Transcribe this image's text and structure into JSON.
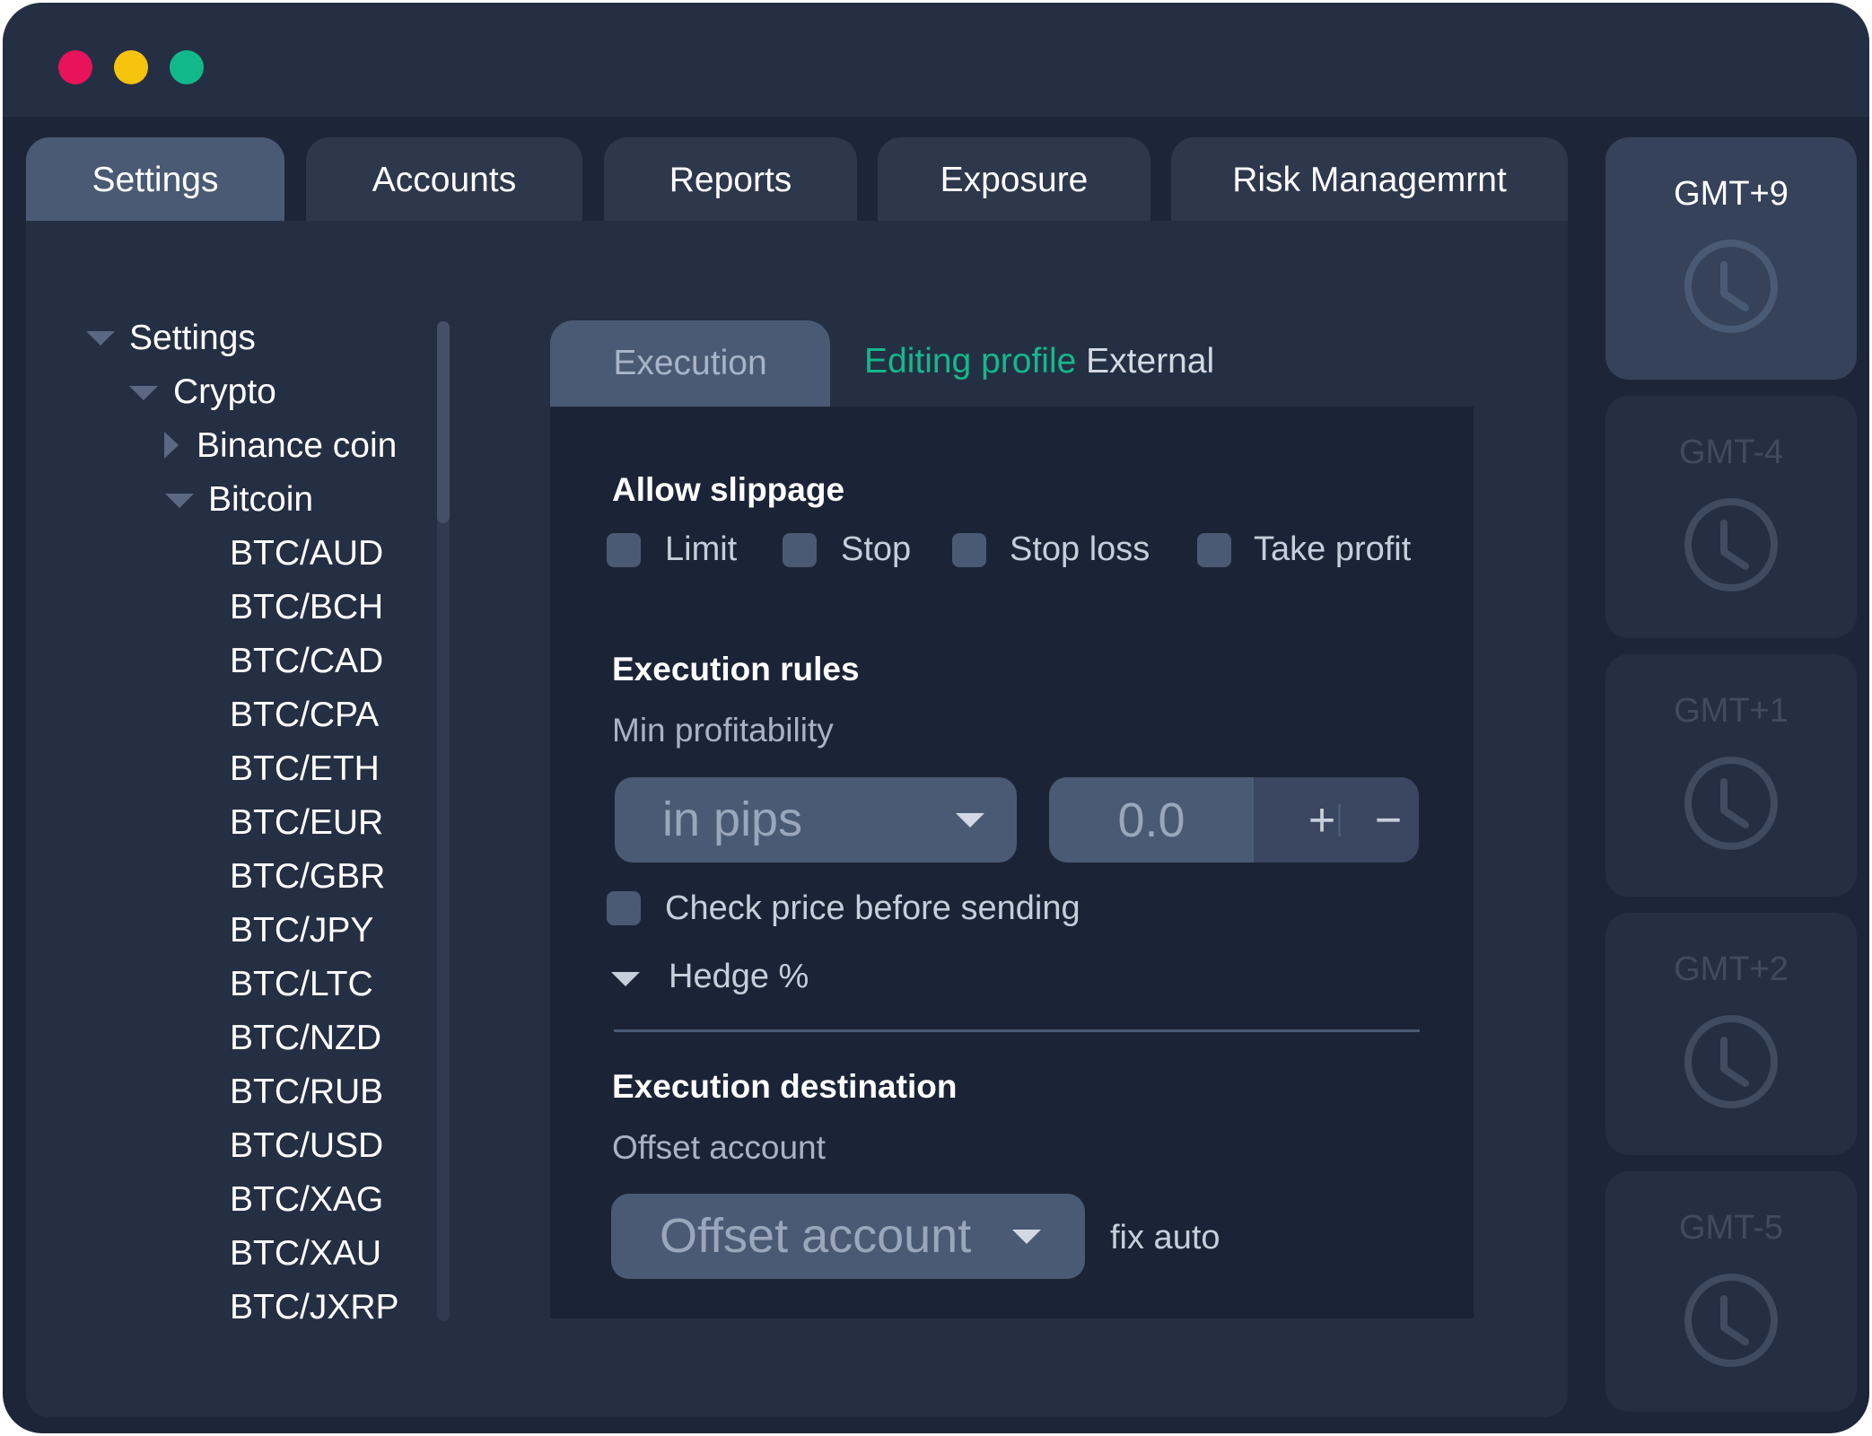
{
  "window": {
    "controls": [
      "close",
      "minimize",
      "maximize"
    ]
  },
  "tabs": [
    {
      "label": "Settings",
      "active": true
    },
    {
      "label": "Accounts",
      "active": false
    },
    {
      "label": "Reports",
      "active": false
    },
    {
      "label": "Exposure",
      "active": false
    },
    {
      "label": "Risk Managemrnt",
      "active": false
    }
  ],
  "tree": {
    "root": "Settings",
    "group": "Crypto",
    "collapsed_item": "Binance coin",
    "expanded_item": "Bitcoin",
    "pairs": [
      "BTC/AUD",
      "BTC/BCH",
      "BTC/CAD",
      "BTC/CPA",
      "BTC/ETH",
      "BTC/EUR",
      "BTC/GBR",
      "BTC/JPY",
      "BTC/LTC",
      "BTC/NZD",
      "BTC/RUB",
      "BTC/USD",
      "BTC/XAG",
      "BTC/XAU",
      "BTC/JXRP"
    ]
  },
  "content": {
    "tab_label": "Execution",
    "editing_label": "Editing profile",
    "editing_profile": "External",
    "allow_slippage": {
      "heading": "Allow slippage",
      "options": [
        "Limit",
        "Stop",
        "Stop loss",
        "Take profit"
      ]
    },
    "execution_rules": {
      "heading": "Execution rules",
      "min_profitability_label": "Min profitability",
      "unit_select": "in pips",
      "value": "0.0",
      "plus": "+",
      "minus": "−",
      "check_price_label": "Check price before sending",
      "hedge_label": "Hedge %"
    },
    "execution_destination": {
      "heading": "Execution destination",
      "offset_label": "Offset account",
      "offset_select": "Offset account",
      "fix_auto": "fix auto"
    }
  },
  "timezones": [
    {
      "label": "GMT+9",
      "active": true
    },
    {
      "label": "GMT-4",
      "active": false
    },
    {
      "label": "GMT+1",
      "active": false
    },
    {
      "label": "GMT+2",
      "active": false
    },
    {
      "label": "GMT-5",
      "active": false
    }
  ],
  "colors": {
    "window_bg": "#1d2639",
    "panel_bg": "#252f43",
    "accent_green": "#13b88c",
    "close_red": "#e8135a",
    "minimize_yellow": "#f6c30d",
    "maximize_green": "#11b98a"
  },
  "icons": {
    "clock": "clock-icon",
    "tree_expanded": "triangle-down-icon",
    "tree_collapsed": "triangle-right-icon",
    "dropdown": "chevron-down-icon"
  }
}
